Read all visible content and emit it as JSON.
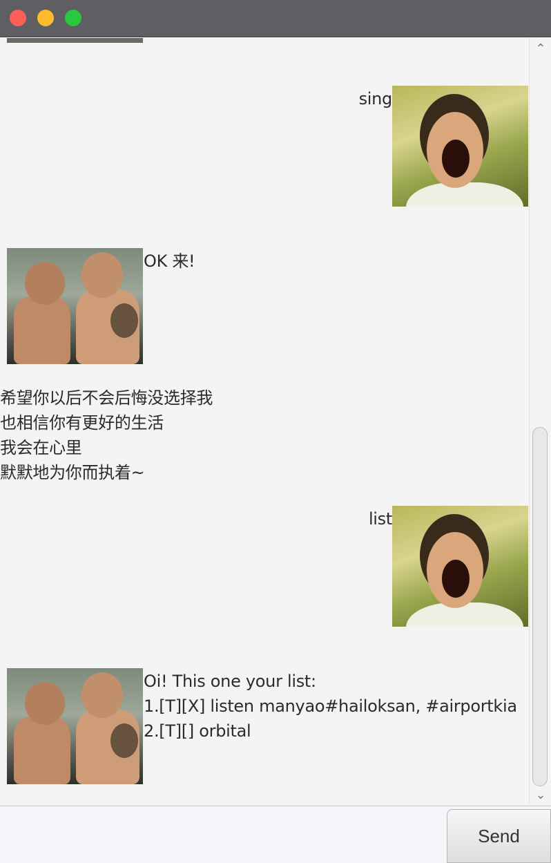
{
  "window": {
    "buttons": [
      "close",
      "minimize",
      "maximize"
    ]
  },
  "messages": [
    {
      "from": "user",
      "text": "sing"
    },
    {
      "from": "bot",
      "text": "OK 来!"
    },
    {
      "from": "bot_lyrics",
      "text": "希望你以后不会后悔没选择我\n也相信你有更好的生活\n我会在心里\n默默地为你而执着~"
    },
    {
      "from": "user",
      "text": "list"
    },
    {
      "from": "bot",
      "text": "Oi! This one your list:\n1.[T][X] listen manyao#hailoksan, #airportkia\n2.[T][] orbital"
    }
  ],
  "input": {
    "value": "",
    "placeholder": ""
  },
  "send_button": {
    "label": "Send"
  },
  "scrollbar": {
    "position_fraction": 0.85
  },
  "icons": {
    "scroll_up": "chevron-up-icon",
    "scroll_down": "chevron-down-icon"
  }
}
